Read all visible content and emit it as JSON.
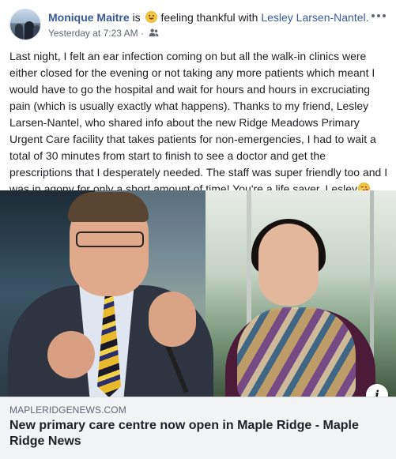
{
  "post": {
    "author": "Monique Maitre",
    "is_word": "is",
    "feeling_text": "feeling thankful with",
    "tagged": "Lesley Larsen-Nantel.",
    "timestamp": "Yesterday at 7:23 AM",
    "separator": "·",
    "audience_icon": "friends-icon",
    "more_icon": "ellipsis-icon",
    "text": "Last night, I felt an ear infection coming on but all the walk-in clinics were either closed for the evening or not taking any more patients which meant I would have to go the hospital and wait for hours and hours in excruciating pain (which is usually exactly what happens). Thanks to my friend, Lesley Larsen-Nantel, who shared info about the new Ridge Meadows Primary Urgent Care facility that takes patients for non-emergencies, I had to wait a total of 30 minutes from start to finish to see a doctor and get the prescriptions that I desperately needed. The staff was super friendly too and I was in agony for only a short amount of time! You're a life saver, Lesley"
  },
  "link_preview": {
    "domain": "MAPLERIDGENEWS.COM",
    "title": "New primary care centre now open in Maple Ridge - Maple Ridge News",
    "info_icon": "info-icon"
  },
  "colors": {
    "name_link": "#385898",
    "secondary_text": "#606770",
    "preview_bg": "#f2f3f5"
  }
}
